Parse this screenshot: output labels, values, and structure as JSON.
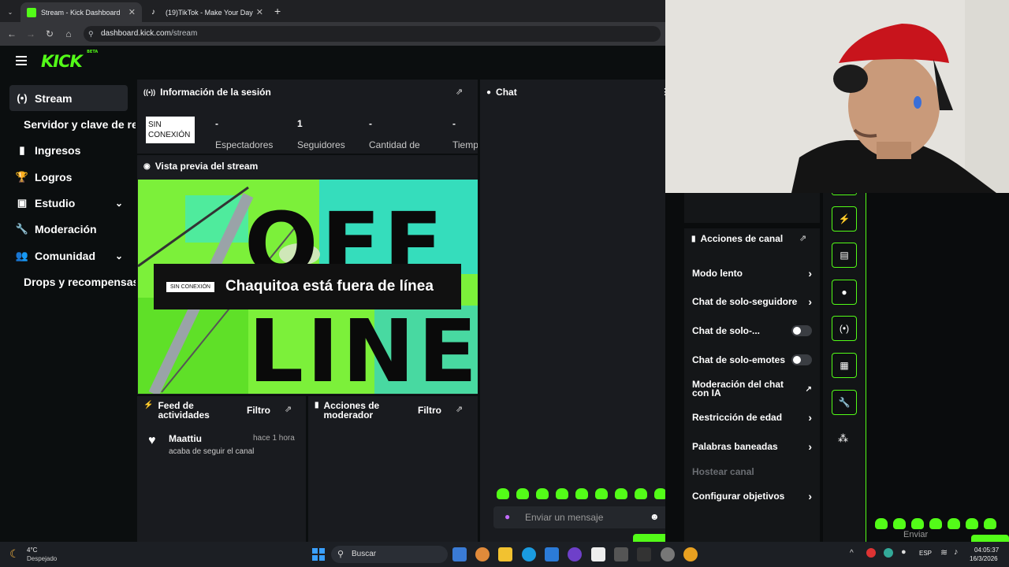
{
  "browser": {
    "tabs": [
      {
        "title": "Stream - Kick Dashboard",
        "active": true
      },
      {
        "title": "(19)TikTok - Make Your Day",
        "active": false
      }
    ],
    "url_host": "dashboard.kick.com",
    "url_path": "/stream"
  },
  "brand": {
    "logo": "KICK",
    "logo_suffix": "BETA",
    "accent": "#53fc18"
  },
  "sidebar": {
    "items": [
      {
        "label": "Stream",
        "icon": "broadcast-icon",
        "active": true
      },
      {
        "label": "Servidor y clave de re",
        "icon": "",
        "sub": true
      },
      {
        "label": "Ingresos",
        "icon": "chart-icon"
      },
      {
        "label": "Logros",
        "icon": "trophy-icon"
      },
      {
        "label": "Estudio",
        "icon": "studio-icon",
        "expandable": true
      },
      {
        "label": "Moderación",
        "icon": "wrench-icon"
      },
      {
        "label": "Comunidad",
        "icon": "people-icon",
        "expandable": true
      },
      {
        "label": "Drops y recompensas",
        "icon": "",
        "sub": true
      }
    ]
  },
  "session": {
    "title": "Información de la sesión",
    "status_line1": "SIN",
    "status_line2": "CONEXIÓN",
    "stats": [
      {
        "value": "-",
        "label": "Espectadores"
      },
      {
        "value": "1",
        "label": "Seguidores"
      },
      {
        "value": "-",
        "label": "Cantidad de"
      },
      {
        "value": "-",
        "label": "Tiemp"
      }
    ]
  },
  "preview": {
    "title": "Vista previa del stream",
    "badge": "SIN CONEXIÓN",
    "offline_text": "Chaquitoa está fuera de línea",
    "bg_word_top": "OFF",
    "bg_word_bottom": "LINE"
  },
  "feed": {
    "title_line1": "Feed de",
    "title_line2": "actividades",
    "filter": "Filtro",
    "items": [
      {
        "user": "Maattiu",
        "time": "hace 1 hora",
        "action": "acaba de seguir el canal"
      }
    ]
  },
  "modactions": {
    "title_line1": "Acciones de",
    "title_line2": "moderador",
    "filter": "Filtro"
  },
  "chat": {
    "title": "Chat",
    "placeholder": "Enviar un mensaje"
  },
  "channel_actions": {
    "title": "Acciones de canal",
    "items": [
      {
        "label": "Modo lento",
        "control": "arrow"
      },
      {
        "label": "Chat de solo-seguidores",
        "control": "arrow"
      },
      {
        "label": "Chat de solo-...",
        "control": "toggle",
        "on": false
      },
      {
        "label": "Chat de solo-emotes",
        "control": "toggle",
        "on": false
      },
      {
        "label_line1": "Moderación del chat",
        "label_line2": "con IA",
        "control": "external"
      },
      {
        "label": "Restricción de edad",
        "control": "arrow"
      },
      {
        "label": "Palabras baneadas",
        "control": "arrow"
      },
      {
        "label": "Hostear canal",
        "control": "none",
        "disabled": true
      },
      {
        "label": "Configurar objetivos",
        "control": "arrow"
      }
    ]
  },
  "second_window": {
    "send_label": "Enviar"
  },
  "taskbar": {
    "weather_temp": "4°C",
    "weather_desc": "Despejado",
    "search": "Buscar",
    "lang": "ESP",
    "time": "04:05:37",
    "date": "16/3/2026"
  }
}
